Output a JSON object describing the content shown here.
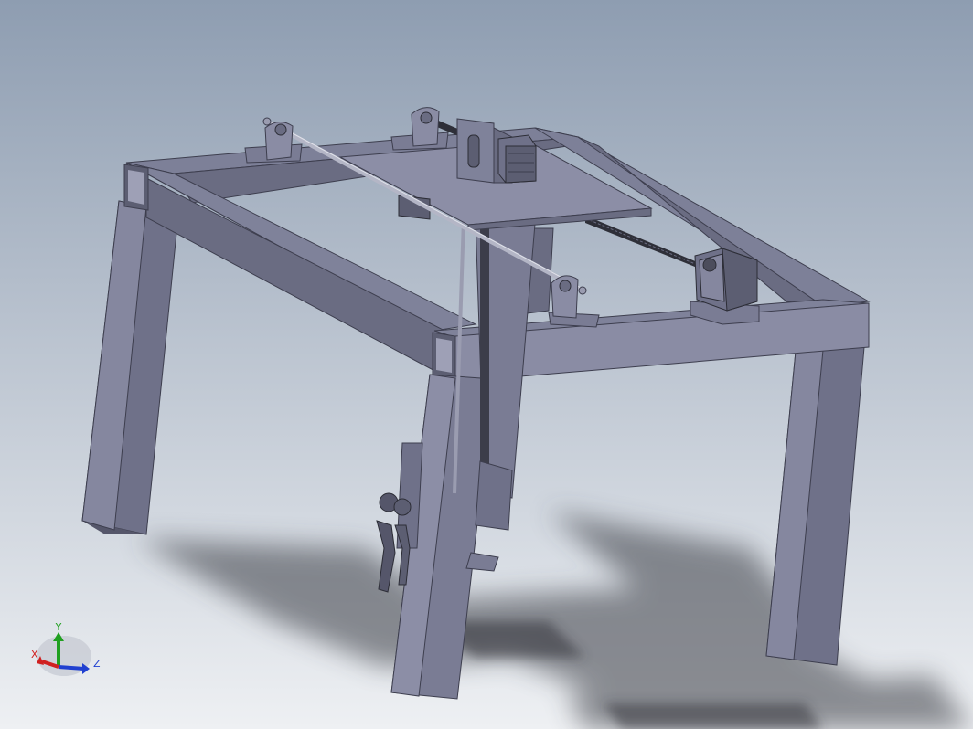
{
  "viewport": {
    "background_top": "#8e9db1",
    "background_bottom": "#eef0f3"
  },
  "model": {
    "frame_top_color": "#7d8098",
    "frame_side_color": "#6a6c82",
    "frame_front_color": "#8a8ca4",
    "part_dark": "#55566a",
    "shadow_color": "#3a3c44"
  },
  "triad": {
    "x_label": "X",
    "y_label": "Y",
    "z_label": "Z",
    "x_color": "#d02020",
    "y_color": "#20a020",
    "z_color": "#2040d0"
  }
}
